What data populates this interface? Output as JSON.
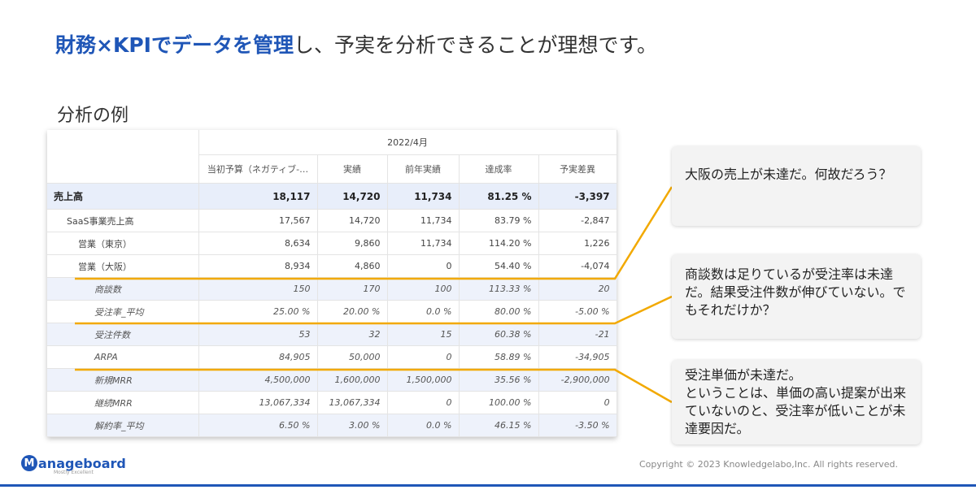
{
  "slide": {
    "title_highlight": "財務×KPIでデータを管理",
    "title_rest": "し、予実を分析できることが理想です。",
    "subtitle": "分析の例"
  },
  "table": {
    "period": "2022/4月",
    "headers": [
      "当初予算（ネガティブ-…",
      "実績",
      "前年実績",
      "達成率",
      "予実差異"
    ],
    "rows": [
      {
        "label": "売上高",
        "values": [
          "18,117",
          "14,720",
          "11,734",
          "81.25 %",
          "-3,397"
        ]
      },
      {
        "label": "SaaS事業売上高",
        "values": [
          "17,567",
          "14,720",
          "11,734",
          "83.79 %",
          "-2,847"
        ]
      },
      {
        "label": "営業（東京）",
        "values": [
          "8,634",
          "9,860",
          "11,734",
          "114.20 %",
          "1,226"
        ]
      },
      {
        "label": "営業（大阪）",
        "values": [
          "8,934",
          "4,860",
          "0",
          "54.40 %",
          "-4,074"
        ]
      },
      {
        "label": "商談数",
        "values": [
          "150",
          "170",
          "100",
          "113.33 %",
          "20"
        ]
      },
      {
        "label": "受注率_平均",
        "values": [
          "25.00 %",
          "20.00 %",
          "0.0 %",
          "80.00 %",
          "-5.00 %"
        ]
      },
      {
        "label": "受注件数",
        "values": [
          "53",
          "32",
          "15",
          "60.38 %",
          "-21"
        ]
      },
      {
        "label": "ARPA",
        "values": [
          "84,905",
          "50,000",
          "0",
          "58.89 %",
          "-34,905"
        ]
      },
      {
        "label": "新規MRR",
        "values": [
          "4,500,000",
          "1,600,000",
          "1,500,000",
          "35.56 %",
          "-2,900,000"
        ]
      },
      {
        "label": "継続MRR",
        "values": [
          "13,067,334",
          "13,067,334",
          "0",
          "100.00 %",
          "0"
        ]
      },
      {
        "label": "解約率_平均",
        "values": [
          "6.50 %",
          "3.00 %",
          "0.0 %",
          "46.15 %",
          "-3.50 %"
        ]
      }
    ]
  },
  "callouts": [
    {
      "text": "大阪の売上が未達だ。何故だろう？"
    },
    {
      "text": "商談数は足りているが受注率は未達だ。結果受注件数が伸びていない。でもそれだけか？"
    },
    {
      "text": "受注単価が未達だ。\nということは、単価の高い提案が出来ていないのと、受注率が低いことが未達要因だ。"
    }
  ],
  "footer": {
    "logo_letter": "M",
    "logo_text": "anageboard",
    "logo_tagline": "Mostly Excellent",
    "copyright": "Copyright © 2023 Knowledgelabo,Inc. All rights reserved."
  },
  "colors": {
    "accent": "#1f56b7",
    "highlight_line": "#f2a900"
  }
}
